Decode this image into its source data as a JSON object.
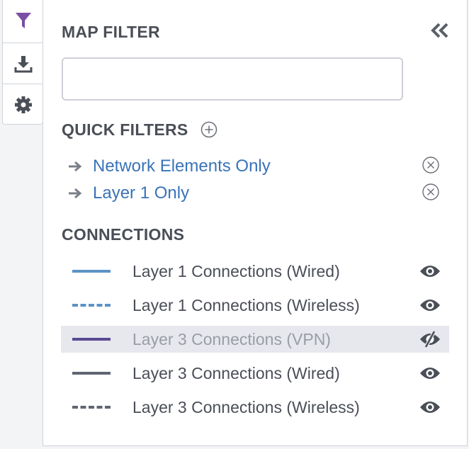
{
  "toolbar": {
    "buttons": [
      {
        "icon": "filter-icon",
        "active": true
      },
      {
        "icon": "download-icon",
        "active": false
      },
      {
        "icon": "gear-icon",
        "active": false
      }
    ]
  },
  "panel": {
    "title": "MAP FILTER",
    "search": {
      "value": "",
      "placeholder": ""
    },
    "quick_filters": {
      "title": "QUICK FILTERS",
      "items": [
        {
          "label": "Network Elements Only"
        },
        {
          "label": "Layer 1 Only"
        }
      ]
    },
    "connections": {
      "title": "CONNECTIONS",
      "items": [
        {
          "label": "Layer 1 Connections (Wired)",
          "color": "#5b93c7",
          "style": "solid",
          "visible": true
        },
        {
          "label": "Layer 1 Connections (Wireless)",
          "color": "#5b93c7",
          "style": "dashed",
          "visible": true
        },
        {
          "label": "Layer 3 Connections (VPN)",
          "color": "#5a4a93",
          "style": "solid",
          "visible": false
        },
        {
          "label": "Layer 3 Connections (Wired)",
          "color": "#5f6670",
          "style": "solid",
          "visible": true
        },
        {
          "label": "Layer 3 Connections (Wireless)",
          "color": "#5f6670",
          "style": "dashed",
          "visible": true
        }
      ]
    }
  },
  "colors": {
    "accent_purple": "#7a4fa3",
    "link_blue": "#3a73b8",
    "heading": "#4a4e57",
    "icon_gray": "#5b5f68"
  }
}
